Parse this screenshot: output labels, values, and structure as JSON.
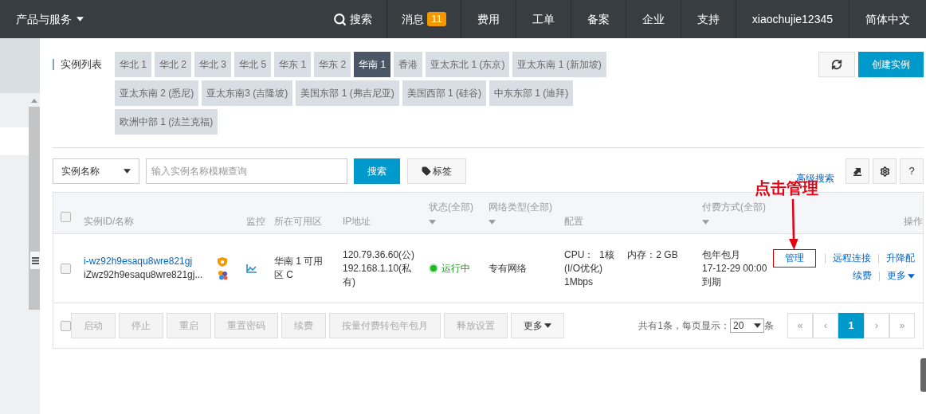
{
  "top_nav": {
    "menu": "产品与服务",
    "items": [
      {
        "kind": "search",
        "label": "搜索"
      },
      {
        "kind": "badge",
        "label": "消息",
        "badge": "11"
      },
      {
        "kind": "plain",
        "label": "费用"
      },
      {
        "kind": "plain",
        "label": "工单"
      },
      {
        "kind": "plain",
        "label": "备案"
      },
      {
        "kind": "plain",
        "label": "企业"
      },
      {
        "kind": "plain",
        "label": "支持"
      },
      {
        "kind": "plain",
        "label": "xiaochujie12345"
      },
      {
        "kind": "plain",
        "label": "简体中文"
      }
    ]
  },
  "page_title": "实例列表",
  "regions": [
    {
      "label": "华北 1",
      "selected": false
    },
    {
      "label": "华北 2",
      "selected": false
    },
    {
      "label": "华北 3",
      "selected": false
    },
    {
      "label": "华北 5",
      "selected": false
    },
    {
      "label": "华东 1",
      "selected": false
    },
    {
      "label": "华东 2",
      "selected": false
    },
    {
      "label": "华南 1",
      "selected": true
    },
    {
      "label": "香港",
      "selected": false
    },
    {
      "label": "亚太东北 1 (东京)",
      "selected": false
    },
    {
      "label": "亚太东南 1 (新加坡)",
      "selected": false
    },
    {
      "label": "亚太东南 2 (悉尼)",
      "selected": false
    },
    {
      "label": "亚太东南3 (吉隆坡)",
      "selected": false
    },
    {
      "label": "美国东部 1 (弗吉尼亚)",
      "selected": false
    },
    {
      "label": "美国西部 1 (硅谷)",
      "selected": false
    },
    {
      "label": "中东东部 1 (迪拜)",
      "selected": false
    },
    {
      "label": "欧洲中部 1 (法兰克福)",
      "selected": false
    }
  ],
  "create_button": "创建实例",
  "filter": {
    "field": "实例名称",
    "placeholder": "输入实例名称模糊查询",
    "search_button": "搜索",
    "tag_button": "标签",
    "advanced_search": "高级搜索"
  },
  "help_button": "?",
  "annotation": "点击管理",
  "table": {
    "header_checked": false,
    "columns": [
      {
        "label": "实例ID/名称",
        "dropdown": false
      },
      {
        "label": "监控",
        "dropdown": false
      },
      {
        "label": "所在可用区",
        "dropdown": false
      },
      {
        "label": "IP地址",
        "dropdown": false
      },
      {
        "label": "状态(全部)",
        "dropdown": true
      },
      {
        "label": "网络类型(全部)",
        "dropdown": true
      },
      {
        "label": "配置",
        "dropdown": false
      },
      {
        "label": "付费方式(全部)",
        "dropdown": true
      },
      {
        "label": "操作",
        "dropdown": false
      }
    ],
    "rows": [
      {
        "checked": false,
        "id": "i-wz92h9esaqu8wre821gj",
        "name": "iZwz92h9esaqu8wre821gj...",
        "zone": "华南 1 可用区 C",
        "ips": [
          "120.79.36.60(公)",
          "192.168.1.10(私有)"
        ],
        "status": {
          "kind": "running",
          "label": "运行中"
        },
        "network": "专有网络",
        "config": [
          "CPU：  1核     内存：2 GB",
          "(I/O优化)",
          "1Mbps"
        ],
        "billing": [
          "包年包月",
          "17-12-29 00:00",
          "到期"
        ],
        "actions": [
          [
            {
              "label": "管理",
              "highlighted": true,
              "dropdown": false
            },
            {
              "label": "远程连接",
              "highlighted": false,
              "dropdown": false
            },
            {
              "label": "升降配",
              "highlighted": false,
              "dropdown": false
            }
          ],
          [
            {
              "label": "续费",
              "highlighted": false,
              "dropdown": false
            },
            {
              "label": "更多",
              "highlighted": false,
              "dropdown": true
            }
          ]
        ]
      }
    ]
  },
  "footer": {
    "checked": false,
    "actions": [
      {
        "label": "启动",
        "disabled": true,
        "dropdown": false
      },
      {
        "label": "停止",
        "disabled": true,
        "dropdown": false
      },
      {
        "label": "重启",
        "disabled": true,
        "dropdown": false
      },
      {
        "label": "重置密码",
        "disabled": true,
        "dropdown": false
      },
      {
        "label": "续费",
        "disabled": true,
        "dropdown": false
      },
      {
        "label": "按量付费转包年包月",
        "disabled": true,
        "dropdown": false
      },
      {
        "label": "释放设置",
        "disabled": true,
        "dropdown": false
      },
      {
        "label": "更多",
        "disabled": false,
        "dropdown": true
      }
    ],
    "total": "共有1条，每页显示：",
    "page_size": "20",
    "unit": "条",
    "pages": [
      {
        "label": "«",
        "selected": false
      },
      {
        "label": "‹",
        "selected": false
      },
      {
        "label": "1",
        "selected": true
      },
      {
        "label": "›",
        "selected": false
      },
      {
        "label": "»",
        "selected": false
      }
    ]
  }
}
